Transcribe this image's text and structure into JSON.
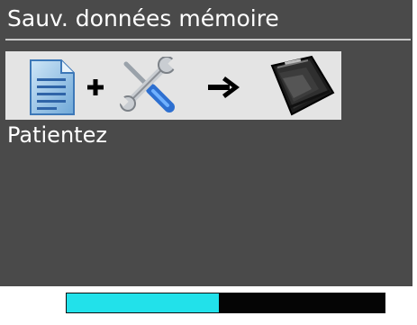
{
  "dialog": {
    "title": "Sauv. données mémoire",
    "status_text": "Patientez"
  },
  "illustration": {
    "icons": [
      "document-icon",
      "plus-icon",
      "tools-icon",
      "arrow-right-icon",
      "memory-card-icon"
    ]
  },
  "progress": {
    "fraction": 0.48
  },
  "colors": {
    "screen_bg": "#4a4a4a",
    "illustration_bg": "#e4e4e4",
    "progress_fill": "#22e1ea",
    "progress_track": "#050505",
    "text": "#ffffff"
  }
}
